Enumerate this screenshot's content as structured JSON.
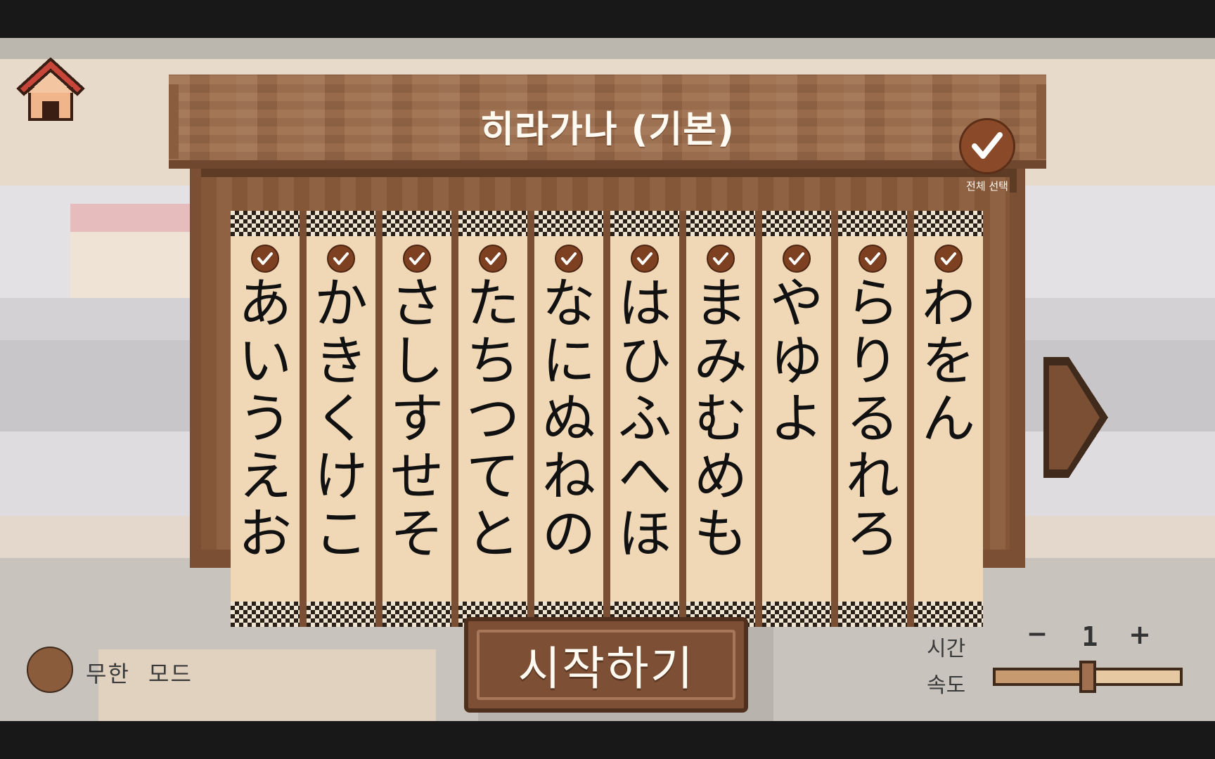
{
  "header": {
    "title": "히라가나 (기본)",
    "select_all_label": "전체 선택",
    "select_all_checked": true
  },
  "columns": [
    {
      "kana": [
        "あ",
        "い",
        "う",
        "え",
        "お"
      ],
      "checked": true
    },
    {
      "kana": [
        "か",
        "き",
        "く",
        "け",
        "こ"
      ],
      "checked": true
    },
    {
      "kana": [
        "さ",
        "し",
        "す",
        "せ",
        "そ"
      ],
      "checked": true
    },
    {
      "kana": [
        "た",
        "ち",
        "つ",
        "て",
        "と"
      ],
      "checked": true
    },
    {
      "kana": [
        "な",
        "に",
        "ぬ",
        "ね",
        "の"
      ],
      "checked": true
    },
    {
      "kana": [
        "は",
        "ひ",
        "ふ",
        "へ",
        "ほ"
      ],
      "checked": true
    },
    {
      "kana": [
        "ま",
        "み",
        "む",
        "め",
        "も"
      ],
      "checked": true
    },
    {
      "kana": [
        "や",
        "ゆ",
        "よ",
        "",
        ""
      ],
      "checked": true
    },
    {
      "kana": [
        "ら",
        "り",
        "る",
        "れ",
        "ろ"
      ],
      "checked": true
    },
    {
      "kana": [
        "わ",
        "を",
        "ん",
        "",
        ""
      ],
      "checked": true
    }
  ],
  "bottom": {
    "infinite_mode_label": "무한  모드",
    "infinite_mode_on": false,
    "start_label": "시작하기",
    "time_label": "시간",
    "time_minus": "−",
    "time_value": "1",
    "time_plus": "+",
    "speed_label": "속도",
    "speed_level": 0.5
  },
  "icons": {
    "home": "home-icon",
    "next": "next-arrow-icon",
    "check": "checkmark-icon"
  },
  "colors": {
    "wood": "#8b5c3c",
    "paper": "#f0d8b6",
    "check_bg": "#7d4122",
    "text_light": "#fffaf2"
  }
}
